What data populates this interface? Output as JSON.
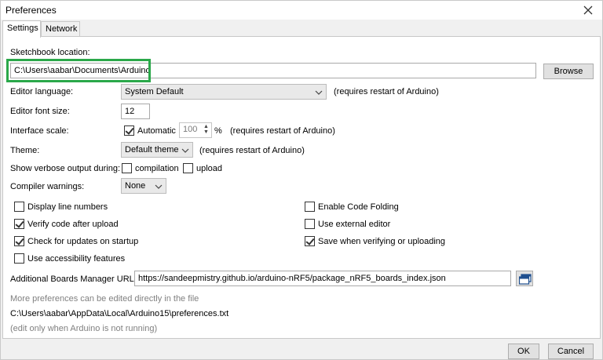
{
  "window": {
    "title": "Preferences"
  },
  "tabs": [
    {
      "label": "Settings",
      "active": true
    },
    {
      "label": "Network",
      "active": false
    }
  ],
  "settings": {
    "sketchbook_label": "Sketchbook location:",
    "sketchbook_value": "C:\\Users\\aabar\\Documents\\Arduino",
    "browse_label": "Browse",
    "editor_language_label": "Editor language:",
    "editor_language_value": "System Default",
    "editor_language_note": "(requires restart of Arduino)",
    "font_size_label": "Editor font size:",
    "font_size_value": "12",
    "interface_scale_label": "Interface scale:",
    "automatic_label": "Automatic",
    "automatic_checked": true,
    "scale_value": "100",
    "percent": "%",
    "interface_scale_note": "(requires restart of Arduino)",
    "theme_label": "Theme:",
    "theme_value": "Default theme",
    "theme_note": "(requires restart of Arduino)",
    "verbose_label": "Show verbose output during:",
    "compilation_label": "compilation",
    "upload_label": "upload",
    "compiler_warnings_label": "Compiler warnings:",
    "compiler_warnings_value": "None",
    "options_left": [
      {
        "label": "Display line numbers",
        "checked": false
      },
      {
        "label": "Verify code after upload",
        "checked": true
      },
      {
        "label": "Check for updates on startup",
        "checked": true
      },
      {
        "label": "Use accessibility features",
        "checked": false
      }
    ],
    "options_right": [
      {
        "label": "Enable Code Folding",
        "checked": false
      },
      {
        "label": "Use external editor",
        "checked": false
      },
      {
        "label": "Save when verifying or uploading",
        "checked": true
      }
    ],
    "boards_url_label": "Additional Boards Manager URLs:",
    "boards_url_value": "https://sandeepmistry.github.io/arduino-nRF5/package_nRF5_boards_index.json",
    "more_prefs_note": "More preferences can be edited directly in the file",
    "prefs_path": "C:\\Users\\aabar\\AppData\\Local\\Arduino15\\preferences.txt",
    "edit_note": "(edit only when Arduino is not running)"
  },
  "footer": {
    "ok_label": "OK",
    "cancel_label": "Cancel"
  },
  "colors": {
    "highlight": "#2aa84a"
  }
}
